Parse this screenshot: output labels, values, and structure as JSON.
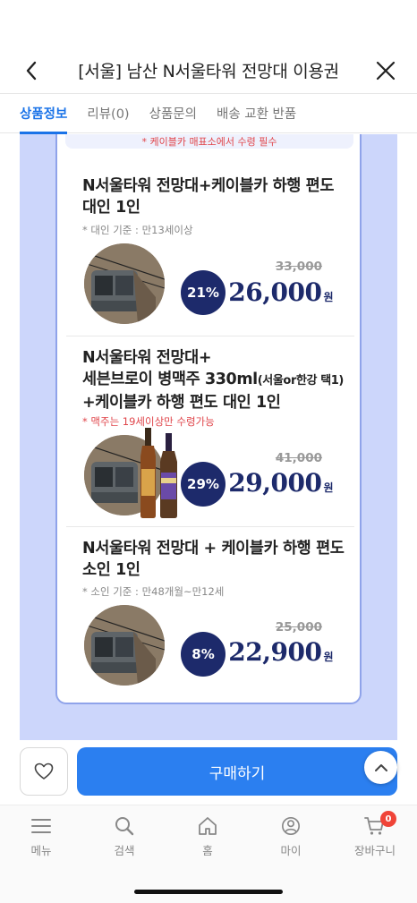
{
  "header": {
    "title": "[서울] 남산 N서울타워 전망대 이용권"
  },
  "tabs": [
    {
      "label": "상품정보",
      "active": true
    },
    {
      "label": "리뷰(0)",
      "active": false
    },
    {
      "label": "상품문의",
      "active": false
    },
    {
      "label": "배송 교환 반품",
      "active": false
    }
  ],
  "notice": "* 케이블카 매표소에서 수령 필수",
  "products": [
    {
      "title_line1": "N서울타워 전망대+케이블카 하행 편도",
      "title_line2": "대인 1인",
      "sub": "* 대인 기준 : 만13세이상",
      "discount": "21%",
      "original_price": "33,000",
      "price": "26,000",
      "unit": "원"
    },
    {
      "title_line1": "N서울타워 전망대+",
      "title_line2a": "세븐브로이 병맥주 330ml",
      "title_line2b": "(서울or한강 택1)",
      "title_line3": "+케이블카 하행 편도 대인 1인",
      "sub": "* 맥주는 19세이상만 수령가능",
      "discount": "29%",
      "original_price": "41,000",
      "price": "29,000",
      "unit": "원"
    },
    {
      "title_line1": "N서울타워 전망대 + 케이블카 하행 편도",
      "title_line2": "소인 1인",
      "sub": "* 소인 기준 : 만48개월~만12세",
      "discount": "8%",
      "original_price": "25,000",
      "price": "22,900",
      "unit": "원"
    }
  ],
  "action": {
    "buy_label": "구매하기"
  },
  "nav": [
    {
      "label": "메뉴",
      "icon": "menu-icon"
    },
    {
      "label": "검색",
      "icon": "search-icon"
    },
    {
      "label": "홈",
      "icon": "home-icon"
    },
    {
      "label": "마이",
      "icon": "profile-icon"
    },
    {
      "label": "장바구니",
      "icon": "cart-icon"
    }
  ],
  "cart_count": "0",
  "colors": {
    "accent": "#2b7ff0",
    "navy": "#1d2a6b",
    "content_bg": "#ccd6fb"
  }
}
